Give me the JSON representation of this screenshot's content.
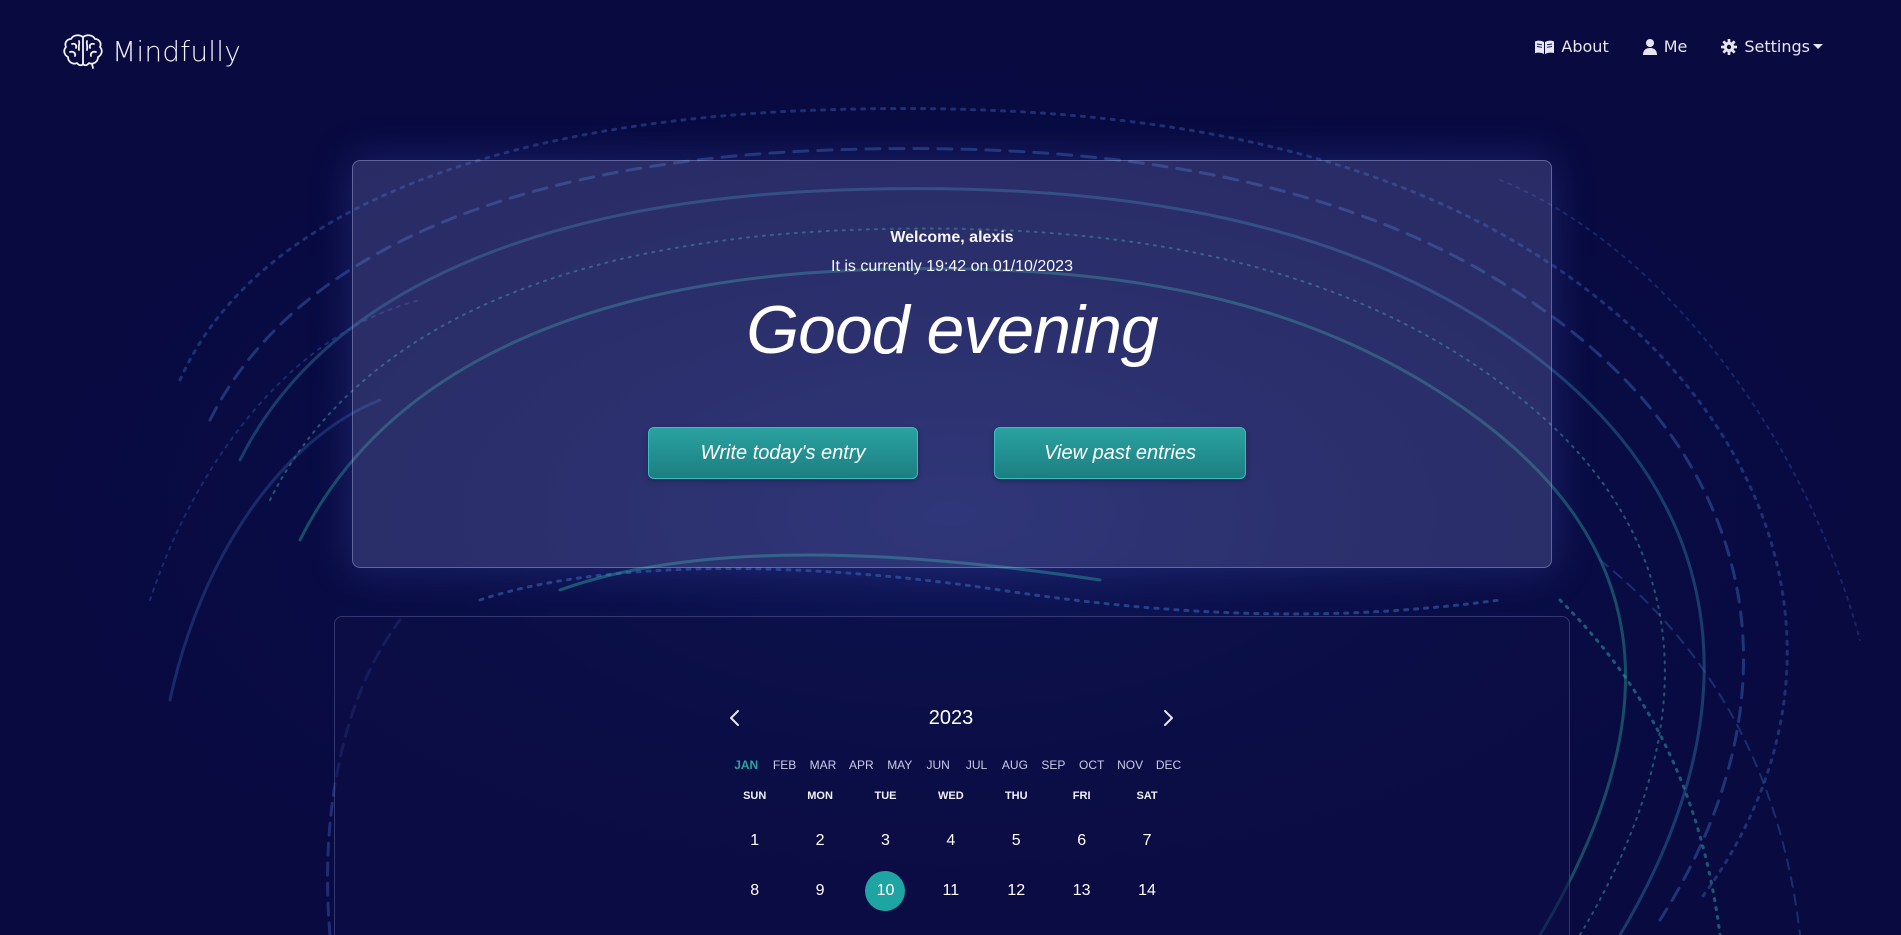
{
  "brand": {
    "name": "Mindfully",
    "icon": "brain-icon"
  },
  "nav": {
    "about": "About",
    "about_icon": "book-open-icon",
    "me": "Me",
    "me_icon": "user-icon",
    "settings": "Settings",
    "settings_icon": "gear-icon"
  },
  "welcome": {
    "greeting_line": "Welcome, alexis",
    "time_line": "It is currently 19:42 on 01/10/2023",
    "headline": "Good evening",
    "write_button": "Write today's entry",
    "past_button": "View past entries"
  },
  "calendar": {
    "year": "2023",
    "prev_icon": "chevron-left-icon",
    "next_icon": "chevron-right-icon",
    "months": [
      "JAN",
      "FEB",
      "MAR",
      "APR",
      "MAY",
      "JUN",
      "JUL",
      "AUG",
      "SEP",
      "OCT",
      "NOV",
      "DEC"
    ],
    "active_month": "JAN",
    "weekdays": [
      "SUN",
      "MON",
      "TUE",
      "WED",
      "THU",
      "FRI",
      "SAT"
    ],
    "weeks": [
      [
        "1",
        "2",
        "3",
        "4",
        "5",
        "6",
        "7"
      ],
      [
        "8",
        "9",
        "10",
        "11",
        "12",
        "13",
        "14"
      ]
    ],
    "today": "10"
  },
  "colors": {
    "background": "#080a40",
    "accent": "#1ea4a2",
    "card": "#3a3d7a"
  }
}
